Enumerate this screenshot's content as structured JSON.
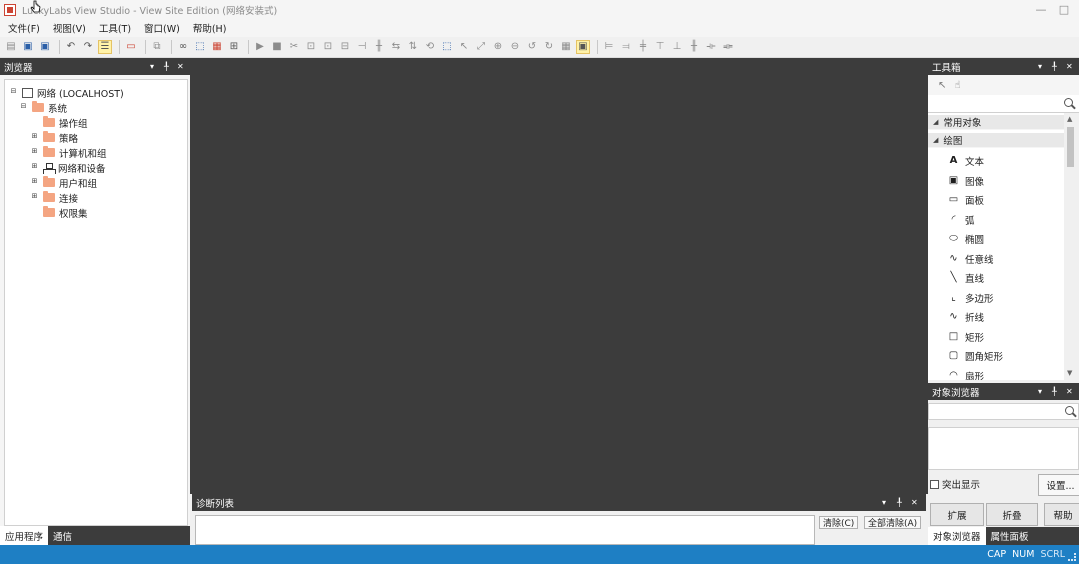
{
  "window": {
    "title": "LuckyLabs View Studio - View Site Edition (网络安装式)",
    "minimize_glyph": "—",
    "maximize_glyph": "□"
  },
  "menu": [
    "文件(F)",
    "视图(V)",
    "工具(T)",
    "窗口(W)",
    "帮助(H)"
  ],
  "browser_panel": {
    "title": "浏览器",
    "tree": [
      {
        "label": "网络 (LOCALHOST)",
        "toggle": "⊟",
        "icon": "network-icon",
        "level": 0
      },
      {
        "label": "系统",
        "toggle": "⊟",
        "icon": "folder-icon",
        "level": 1
      },
      {
        "label": "操作组",
        "toggle": "",
        "icon": "folder-icon",
        "level": 2
      },
      {
        "label": "策略",
        "toggle": "⊞",
        "icon": "folder-icon",
        "level": 2
      },
      {
        "label": "计算机和组",
        "toggle": "⊞",
        "icon": "folder-icon",
        "level": 2
      },
      {
        "label": "网络和设备",
        "toggle": "⊞",
        "icon": "devices-icon",
        "level": 2
      },
      {
        "label": "用户和组",
        "toggle": "⊞",
        "icon": "folder-icon",
        "level": 2
      },
      {
        "label": "连接",
        "toggle": "⊞",
        "icon": "folder-icon",
        "level": 2
      },
      {
        "label": "权限集",
        "toggle": "",
        "icon": "folder-icon",
        "level": 2
      }
    ],
    "tabs": [
      {
        "label": "应用程序",
        "active": true
      },
      {
        "label": "通信",
        "active": false
      }
    ]
  },
  "diagnostics_panel": {
    "title": "诊断列表",
    "clear_label": "清除(C)",
    "clear_all_label": "全部清除(A)"
  },
  "toolbox_panel": {
    "title": "工具箱",
    "categories": [
      "常用对象",
      "绘图"
    ],
    "items": [
      {
        "label": "文本",
        "glyph": "A"
      },
      {
        "label": "图像",
        "glyph": "▣"
      },
      {
        "label": "面板",
        "glyph": "▭"
      },
      {
        "label": "弧",
        "glyph": "◜"
      },
      {
        "label": "椭圆",
        "glyph": "⬭"
      },
      {
        "label": "任意线",
        "glyph": "∿"
      },
      {
        "label": "直线",
        "glyph": "╲"
      },
      {
        "label": "多边形",
        "glyph": "⌞"
      },
      {
        "label": "折线",
        "glyph": "∿"
      },
      {
        "label": "矩形",
        "glyph": "□"
      },
      {
        "label": "圆角矩形",
        "glyph": "▢"
      },
      {
        "label": "扇形",
        "glyph": "◠"
      }
    ]
  },
  "object_browser_panel": {
    "title": "对象浏览器",
    "highlight_label": "突出显示",
    "settings_label": "设置...",
    "expand_label": "扩展",
    "collapse_label": "折叠",
    "help_label": "帮助",
    "tabs": [
      {
        "label": "对象浏览器",
        "active": true
      },
      {
        "label": "属性面板",
        "active": false
      }
    ]
  },
  "panel_controls": {
    "dropdown": "▾",
    "pin": "╀",
    "close": "✕"
  },
  "statusbar": {
    "cap": "CAP",
    "num": "NUM",
    "scrl": "SCRL"
  },
  "colors": {
    "dark_panel": "#3c3c3c",
    "statusbar": "#1e7fc4",
    "folder": "#f4a582"
  }
}
